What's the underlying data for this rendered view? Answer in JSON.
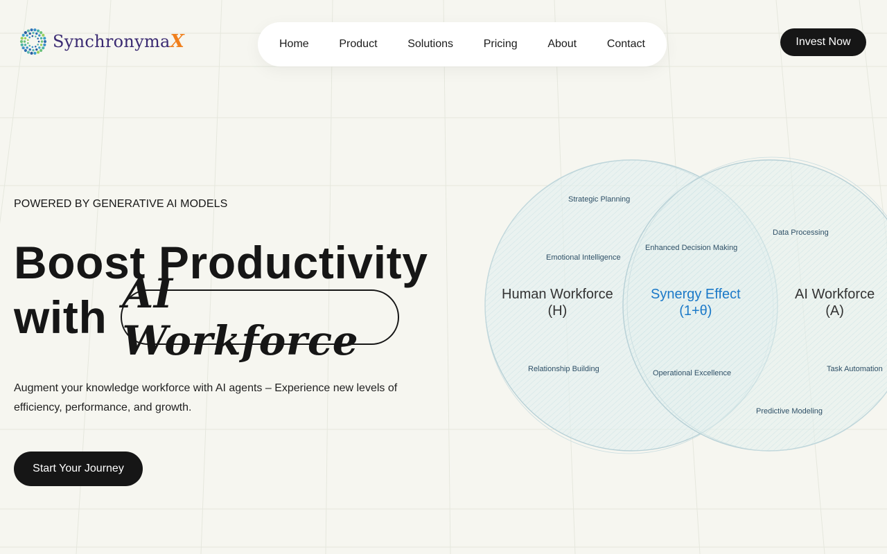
{
  "brand": {
    "name": "Synchronyma",
    "suffix": "X"
  },
  "nav": {
    "items": [
      "Home",
      "Product",
      "Solutions",
      "Pricing",
      "About",
      "Contact"
    ]
  },
  "header": {
    "cta_label": "Invest Now"
  },
  "hero": {
    "eyebrow": "POWERED BY GENERATIVE AI MODELS",
    "headline_line1": "Boost Productivity",
    "headline_with": "with",
    "headline_highlight": "AI Workforce",
    "subtext": "Augment your knowledge workforce with AI agents – Experience new levels of efficiency, performance, and growth.",
    "cta_label": "Start Your Journey"
  },
  "venn": {
    "human": {
      "title": "Human Workforce",
      "symbol": "(H)"
    },
    "synergy": {
      "title": "Synergy Effect",
      "symbol": "(1+θ)"
    },
    "ai": {
      "title": "AI Workforce",
      "symbol": "(A)"
    },
    "labels": {
      "strategic_planning": "Strategic Planning",
      "emotional_intelligence": "Emotional Intelligence",
      "relationship_building": "Relationship Building",
      "enhanced_decision_making": "Enhanced Decision Making",
      "operational_excellence": "Operational Excellence",
      "data_processing": "Data Processing",
      "task_automation": "Task Automation",
      "predictive_modeling": "Predictive Modeling"
    }
  },
  "colors": {
    "background": "#f6f6f0",
    "dark": "#161616",
    "brand_purple": "#3a2a72",
    "brand_orange": "#f07f1c",
    "synergy_blue": "#1b79c8",
    "circle_fill": "#d8ecee"
  }
}
